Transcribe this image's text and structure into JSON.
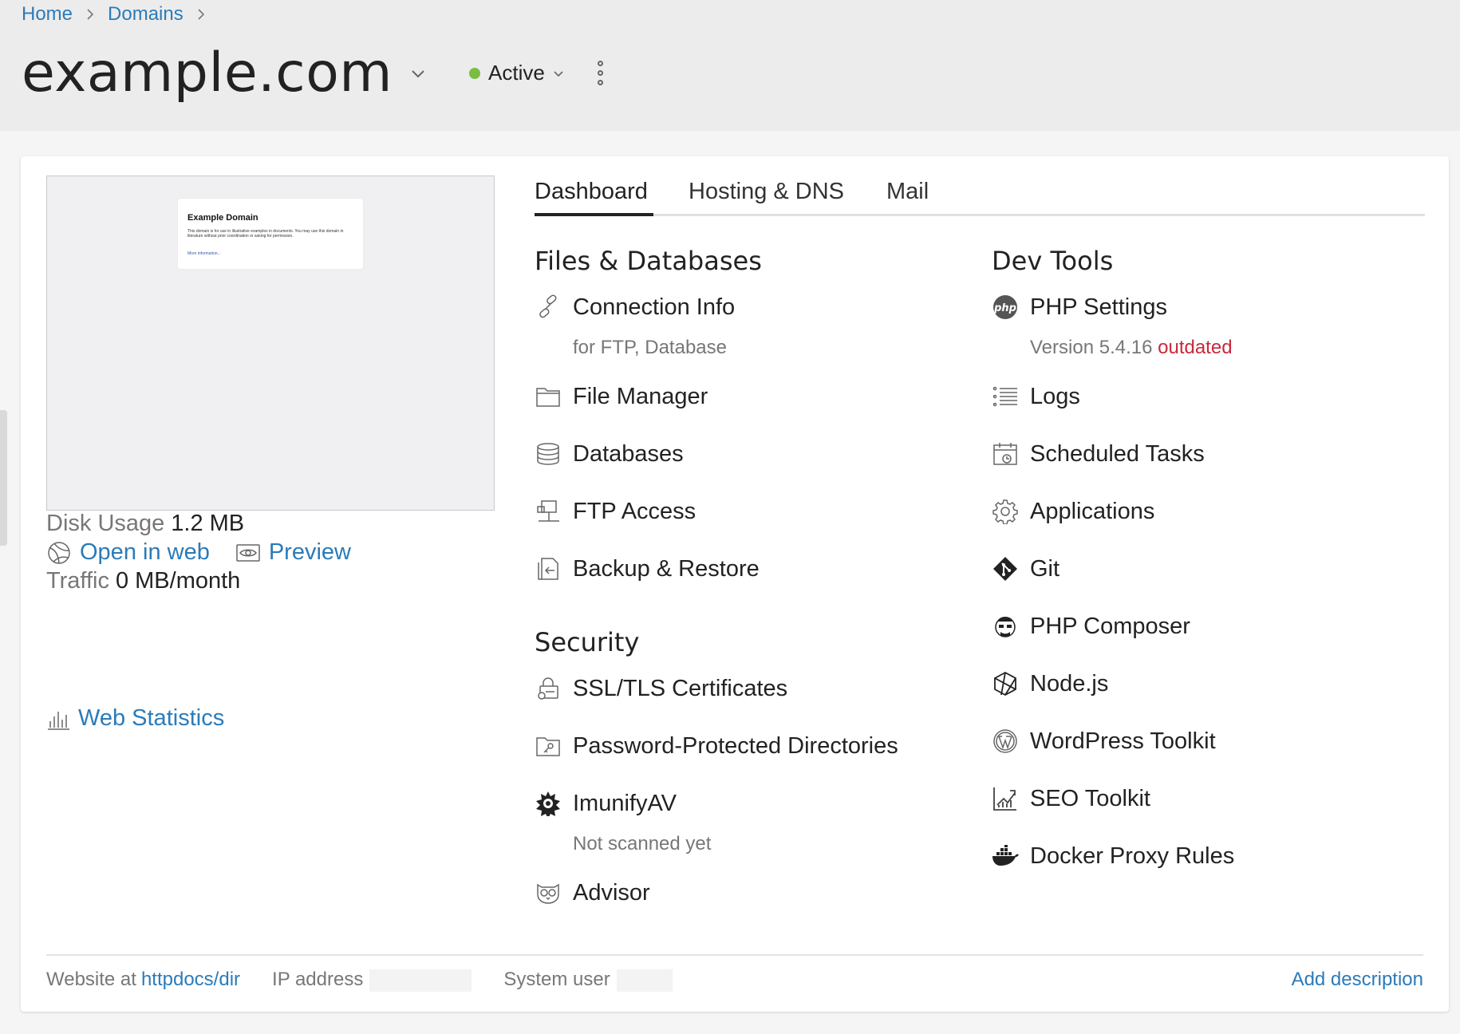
{
  "breadcrumb": {
    "home": "Home",
    "domains": "Domains"
  },
  "header": {
    "title": "example.com",
    "status": "Active",
    "status_color": "#7bbd42"
  },
  "preview_thumb": {
    "title": "Example Domain",
    "text": "This domain is for use in illustrative examples in documents. You may use this domain in literature without prior coordination or asking for permission.",
    "link": "More information..."
  },
  "quick_links": {
    "open_in_web": "Open in web",
    "preview": "Preview"
  },
  "stats": {
    "disk_label": "Disk Usage",
    "disk_value": "1.2 MB",
    "traffic_label": "Traffic",
    "traffic_value": "0 MB/month",
    "web_statistics": "Web Statistics"
  },
  "tabs": [
    "Dashboard",
    "Hosting & DNS",
    "Mail"
  ],
  "files_databases": {
    "title": "Files & Databases",
    "items": [
      {
        "label": "Connection Info",
        "sub": "for FTP, Database",
        "icon": "link-icon"
      },
      {
        "label": "File Manager",
        "icon": "folder-icon"
      },
      {
        "label": "Databases",
        "icon": "database-icon"
      },
      {
        "label": "FTP Access",
        "icon": "ftp-icon"
      },
      {
        "label": "Backup & Restore",
        "icon": "backup-icon"
      }
    ]
  },
  "security": {
    "title": "Security",
    "items": [
      {
        "label": "SSL/TLS Certificates",
        "icon": "ssl-lock-icon"
      },
      {
        "label": "Password-Protected Directories",
        "icon": "protected-folder-icon"
      },
      {
        "label": "ImunifyAV",
        "sub": "Not scanned yet",
        "icon": "imunify-icon"
      },
      {
        "label": "Advisor",
        "icon": "advisor-owl-icon"
      }
    ]
  },
  "dev_tools": {
    "title": "Dev Tools",
    "items": [
      {
        "label": "PHP Settings",
        "sub": "Version 5.4.16",
        "warn": "outdated",
        "icon": "php-icon"
      },
      {
        "label": "Logs",
        "icon": "logs-icon"
      },
      {
        "label": "Scheduled Tasks",
        "icon": "calendar-clock-icon"
      },
      {
        "label": "Applications",
        "icon": "gear-icon"
      },
      {
        "label": "Git",
        "icon": "git-icon"
      },
      {
        "label": "PHP Composer",
        "icon": "composer-icon"
      },
      {
        "label": "Node.js",
        "icon": "nodejs-icon"
      },
      {
        "label": "WordPress Toolkit",
        "icon": "wordpress-icon"
      },
      {
        "label": "SEO Toolkit",
        "icon": "seo-chart-icon"
      },
      {
        "label": "Docker Proxy Rules",
        "icon": "docker-icon"
      }
    ]
  },
  "footer": {
    "website_at": "Website at",
    "website_path": "httpdocs/dir",
    "ip_label": "IP address",
    "system_user_label": "System user",
    "add_description": "Add description"
  },
  "colors": {
    "link": "#2b7bb9",
    "warning": "#c8283a"
  }
}
